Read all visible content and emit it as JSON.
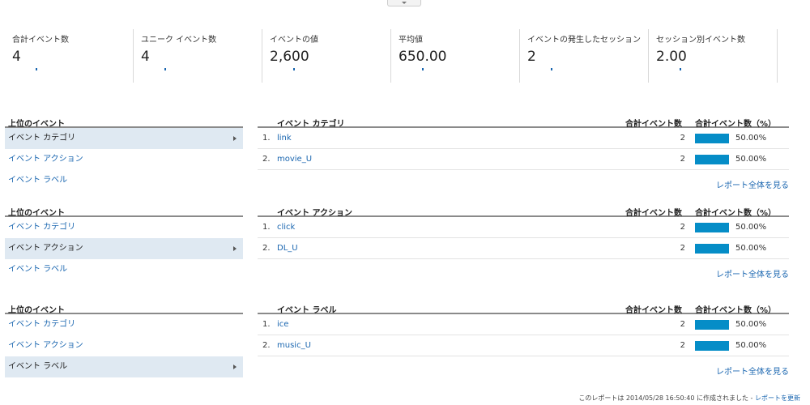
{
  "metrics": [
    {
      "label": "合計イベント数",
      "value": "4"
    },
    {
      "label": "ユニーク イベント数",
      "value": "4"
    },
    {
      "label": "イベントの値",
      "value": "2,600"
    },
    {
      "label": "平均値",
      "value": "650.00"
    },
    {
      "label": "イベントの発生したセッション",
      "value": "2"
    },
    {
      "label": "セッション別イベント数",
      "value": "2.00"
    }
  ],
  "sections": [
    {
      "left_title": "上位のイベント",
      "left_items": [
        "イベント カテゴリ",
        "イベント アクション",
        "イベント ラベル"
      ],
      "active": 0,
      "dim_header": "イベント カテゴリ",
      "total_header": "合計イベント数",
      "pct_header": "合計イベント数（%）",
      "rows": [
        {
          "idx": "1.",
          "dim": "link",
          "value": "2",
          "pct": "50.00%",
          "share": 0.5
        },
        {
          "idx": "2.",
          "dim": "movie_U",
          "value": "2",
          "pct": "50.00%",
          "share": 0.5
        }
      ],
      "full_link": "レポート全体を見る"
    },
    {
      "left_title": "上位のイベント",
      "left_items": [
        "イベント カテゴリ",
        "イベント アクション",
        "イベント ラベル"
      ],
      "active": 1,
      "dim_header": "イベント アクション",
      "total_header": "合計イベント数",
      "pct_header": "合計イベント数（%）",
      "rows": [
        {
          "idx": "1.",
          "dim": "click",
          "value": "2",
          "pct": "50.00%",
          "share": 0.5
        },
        {
          "idx": "2.",
          "dim": "DL_U",
          "value": "2",
          "pct": "50.00%",
          "share": 0.5
        }
      ],
      "full_link": "レポート全体を見る"
    },
    {
      "left_title": "上位のイベント",
      "left_items": [
        "イベント カテゴリ",
        "イベント アクション",
        "イベント ラベル"
      ],
      "active": 2,
      "dim_header": "イベント ラベル",
      "total_header": "合計イベント数",
      "pct_header": "合計イベント数（%）",
      "rows": [
        {
          "idx": "1.",
          "dim": "ice",
          "value": "2",
          "pct": "50.00%",
          "share": 0.5
        },
        {
          "idx": "2.",
          "dim": "music_U",
          "value": "2",
          "pct": "50.00%",
          "share": 0.5
        }
      ],
      "full_link": "レポート全体を見る"
    }
  ],
  "footer": {
    "text": "このレポートは 2014/05/28 16:50:40 に作成されました -",
    "link": "レポートを更新"
  },
  "colors": {
    "bar": "#058dc7",
    "link": "#1a66b0",
    "active_bg": "#dfe9f2"
  }
}
